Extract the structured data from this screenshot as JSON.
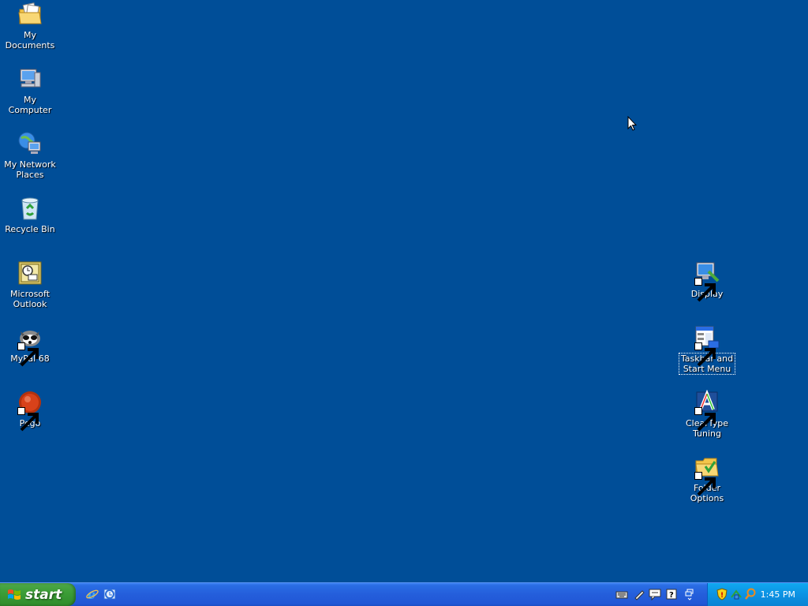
{
  "desktop": {
    "background_color": "#004e98",
    "icons_left": [
      {
        "label": "My Documents",
        "icon": "my-documents-icon"
      },
      {
        "label": "My Computer",
        "icon": "my-computer-icon"
      },
      {
        "label": "My Network\nPlaces",
        "icon": "network-places-icon"
      },
      {
        "label": "Recycle Bin",
        "icon": "recycle-bin-icon"
      },
      {
        "label": "Microsoft\nOutlook",
        "icon": "outlook-icon"
      },
      {
        "label": "MyPal 68",
        "icon": "mypal-icon"
      },
      {
        "label": "Pego",
        "icon": "pego-icon"
      }
    ],
    "icons_right": [
      {
        "label": "Display",
        "icon": "display-icon"
      },
      {
        "label": "Taskbar and\nStart Menu",
        "icon": "taskbar-start-menu-icon",
        "selected": true
      },
      {
        "label": "ClearType\nTuning",
        "icon": "cleartype-icon"
      },
      {
        "label": "Folder Options",
        "icon": "folder-options-icon"
      }
    ]
  },
  "taskbar": {
    "start_label": "start",
    "quick_launch": [
      "internet-explorer-icon",
      "outlook-express-icon"
    ],
    "toolbar_icons": [
      "keyboard-icon",
      "pen-icon",
      "speech-icon",
      "help-icon",
      "restore-icon"
    ],
    "tray_icons": [
      "security-shield-icon",
      "network-icon",
      "search-icon"
    ],
    "clock": "1:45 PM"
  }
}
